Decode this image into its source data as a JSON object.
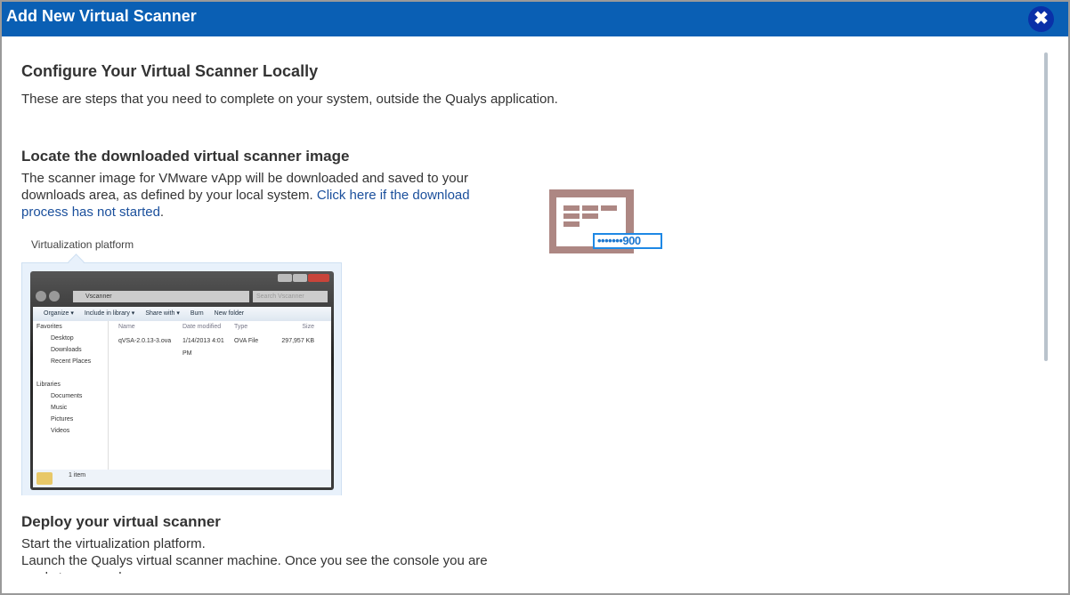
{
  "dialog": {
    "title": "Add New Virtual Scanner",
    "close_icon": "close-icon"
  },
  "config": {
    "heading": "Configure Your Virtual Scanner Locally",
    "description": "These are steps that you need to complete on your system, outside the Qualys application."
  },
  "locate": {
    "heading": "Locate the downloaded virtual scanner image",
    "text": "The scanner image for VMware vApp will be downloaded and saved to your downloads area, as defined by your local system. ",
    "link": "Click here if the download process has not started",
    "after_link": ".",
    "platform_label": "Virtualization platform"
  },
  "explorer": {
    "address": "Vscanner",
    "search": "Search Vscanner",
    "toolbar": [
      "Organize ▾",
      "Include in library ▾",
      "Share with ▾",
      "Burn",
      "New folder"
    ],
    "nav": [
      {
        "label": "Favorites",
        "group": true
      },
      {
        "label": "Desktop"
      },
      {
        "label": "Downloads"
      },
      {
        "label": "Recent Places"
      },
      {
        "label": "",
        "group": true
      },
      {
        "label": "Libraries",
        "group": true
      },
      {
        "label": "Documents"
      },
      {
        "label": "Music"
      },
      {
        "label": "Pictures"
      },
      {
        "label": "Videos"
      }
    ],
    "columns": [
      "Name",
      "Date modified",
      "Type",
      "Size"
    ],
    "file": [
      "qVSA-2.0.13-3.ova",
      "1/14/2013 4:01 PM",
      "OVA File",
      "297,957 KB"
    ],
    "status": "1 item"
  },
  "scanner_icon": {
    "text": "•••••••900"
  },
  "deploy": {
    "heading": "Deploy your virtual scanner",
    "line1": "Start the virtualization platform.",
    "line2": "Launch the Qualys virtual scanner machine. Once you see the console you are ready to proceed."
  }
}
